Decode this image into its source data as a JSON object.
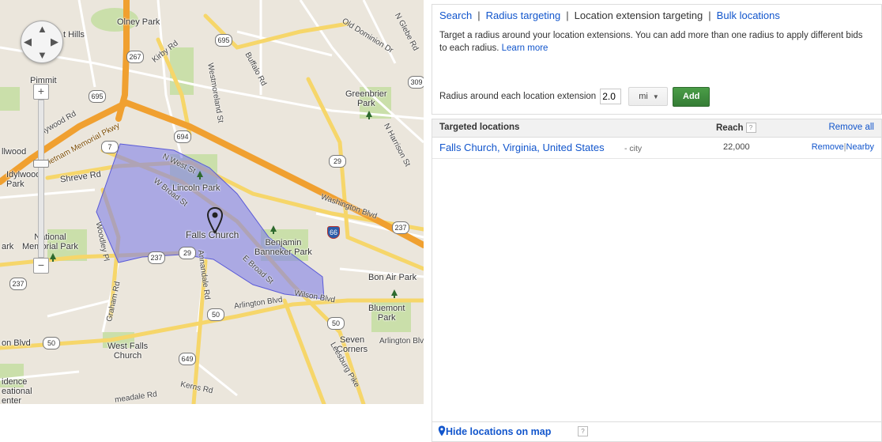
{
  "map": {
    "places": [
      {
        "id": "olney-park",
        "text": "Olney Park"
      },
      {
        "id": "hills",
        "text": "t Hills"
      },
      {
        "id": "old-dominion",
        "text": "Old Dominion Dr"
      },
      {
        "id": "n-glebe",
        "text": "N Glebe Rd"
      },
      {
        "id": "kirby",
        "text": "Kirby Rd"
      },
      {
        "id": "westmoreland",
        "text": "Westmoreland St"
      },
      {
        "id": "buffalo",
        "text": "Buffalo Rd"
      },
      {
        "id": "pimmit",
        "text": "Pimmit"
      },
      {
        "id": "greenbrier",
        "text": "Greenbrier\nPark"
      },
      {
        "id": "hollywood",
        "text": "llywood Rd"
      },
      {
        "id": "memorial",
        "text": "Vietnam Memorial Pkwy"
      },
      {
        "id": "lwood",
        "text": "llwood"
      },
      {
        "id": "n-harrison",
        "text": "N Harrison St"
      },
      {
        "id": "idylwood",
        "text": "Idylwood\nPark"
      },
      {
        "id": "shreve",
        "text": "Shreve Rd"
      },
      {
        "id": "n-west",
        "text": "N West St"
      },
      {
        "id": "lincoln",
        "text": "Lincoln Park"
      },
      {
        "id": "w-broad",
        "text": "W Broad St"
      },
      {
        "id": "washington",
        "text": "Washington Blvd"
      },
      {
        "id": "falls-church",
        "text": "Falls Church"
      },
      {
        "id": "benjamin",
        "text": "Benjamin\nBanneker Park"
      },
      {
        "id": "national",
        "text": "National\nMemorial Park"
      },
      {
        "id": "ark",
        "text": "ark"
      },
      {
        "id": "woodley",
        "text": "Woodley Pl"
      },
      {
        "id": "e-broad",
        "text": "E Broad St"
      },
      {
        "id": "annandale",
        "text": "Annandale Rd"
      },
      {
        "id": "bon-air",
        "text": "Bon Air Park"
      },
      {
        "id": "graham",
        "text": "Graham Rd"
      },
      {
        "id": "arlington-blvd",
        "text": "Arlington Blvd"
      },
      {
        "id": "wilson",
        "text": "Wilson Blvd"
      },
      {
        "id": "bluemont",
        "text": "Bluemont\nPark"
      },
      {
        "id": "on-blvd",
        "text": "on Blvd"
      },
      {
        "id": "west-falls",
        "text": "West Falls\nChurch"
      },
      {
        "id": "seven",
        "text": "Seven\nCorners"
      },
      {
        "id": "arlington-blvd2",
        "text": "Arlington Blvd"
      },
      {
        "id": "leesburg",
        "text": "Leesburg Pike"
      },
      {
        "id": "idence",
        "text": "idence\neational\nenter"
      },
      {
        "id": "kerns",
        "text": "Kerns Rd"
      },
      {
        "id": "meadale",
        "text": "meadale Rd"
      }
    ],
    "shields": [
      {
        "id": "s267",
        "text": "267"
      },
      {
        "id": "s695a",
        "text": "695"
      },
      {
        "id": "s695b",
        "text": "695"
      },
      {
        "id": "s309",
        "text": "309"
      },
      {
        "id": "s7",
        "text": "7"
      },
      {
        "id": "s694",
        "text": "694"
      },
      {
        "id": "s29a",
        "text": "29"
      },
      {
        "id": "s237a",
        "text": "237"
      },
      {
        "id": "s237b",
        "text": "237"
      },
      {
        "id": "s29b",
        "text": "29"
      },
      {
        "id": "s237c",
        "text": "237"
      },
      {
        "id": "s50a",
        "text": "50"
      },
      {
        "id": "s50b",
        "text": "50"
      },
      {
        "id": "s50c",
        "text": "50"
      },
      {
        "id": "s649",
        "text": "649"
      },
      {
        "id": "s66",
        "text": "66"
      }
    ],
    "controls": {
      "zoom_in": "+",
      "zoom_out": "−",
      "pan_up": "▲",
      "pan_down": "▼",
      "pan_left": "◀",
      "pan_right": "▶"
    }
  },
  "tabs": {
    "search": "Search",
    "radius": "Radius targeting",
    "location_ext": "Location extension targeting",
    "bulk": "Bulk locations",
    "sep": "|"
  },
  "description": {
    "text": "Target a radius around your location extensions. You can add more than one radius to apply different bids to each radius.",
    "learn_more": "Learn more"
  },
  "radius": {
    "label": "Radius around each location extension",
    "value": "2.0",
    "unit": "mi",
    "add_label": "Add"
  },
  "list": {
    "col_locations": "Targeted locations",
    "col_reach": "Reach",
    "help": "?",
    "remove_all": "Remove all",
    "rows": [
      {
        "location": "Falls Church, Virginia, United States",
        "type": "- city",
        "reach": "22,000",
        "remove": "Remove",
        "sep": "|",
        "nearby": "Nearby"
      }
    ]
  },
  "footer": {
    "hide_label": "Hide locations on map",
    "help": "?"
  }
}
